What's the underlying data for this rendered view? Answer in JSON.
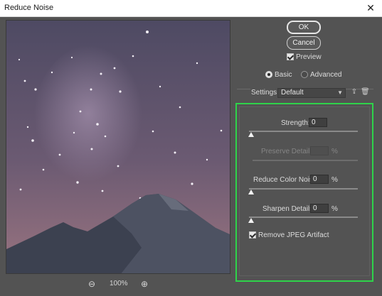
{
  "window": {
    "title": "Reduce Noise",
    "close_glyph": "✕"
  },
  "buttons": {
    "ok": "OK",
    "cancel": "Cancel"
  },
  "preview_checkbox": {
    "label": "Preview",
    "checked": true
  },
  "mode": {
    "basic": "Basic",
    "advanced": "Advanced",
    "selected": "Basic"
  },
  "settings": {
    "label": "Settings:",
    "value": "Default",
    "save_icon": "save-preset-icon",
    "delete_icon": "trash-icon"
  },
  "controls": {
    "strength": {
      "label": "Strength:",
      "value": "0"
    },
    "preserve_details": {
      "label": "Preserve Details:",
      "value": "",
      "unit": "%",
      "disabled": true
    },
    "reduce_color_noise": {
      "label": "Reduce Color Noise:",
      "value": "0",
      "unit": "%"
    },
    "sharpen_details": {
      "label": "Sharpen Details:",
      "value": "0",
      "unit": "%"
    },
    "remove_jpeg_artifact": {
      "label": "Remove JPEG Artifact",
      "checked": true
    }
  },
  "zoom": {
    "level": "100%",
    "zoom_out_icon": "zoom-out-icon",
    "zoom_in_icon": "zoom-in-icon"
  },
  "colors": {
    "highlight": "#2ed34a",
    "panel": "#535353",
    "sky": "#5d5266",
    "mountain": "#3c4150"
  }
}
